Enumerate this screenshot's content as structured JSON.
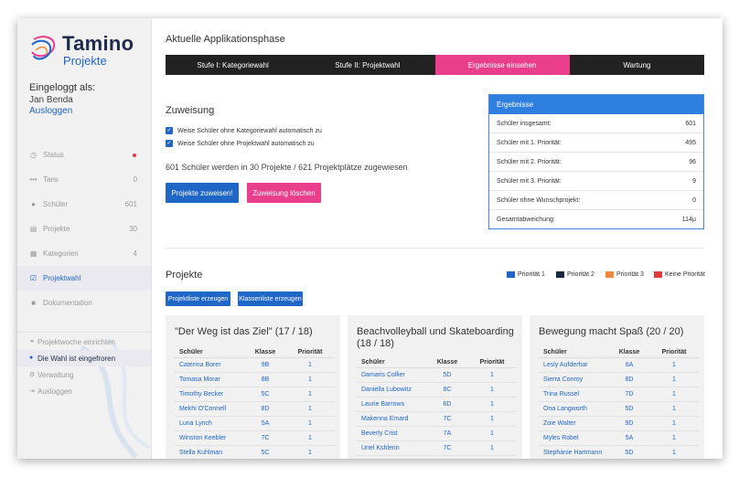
{
  "sidebar": {
    "logo_title": "Tamino",
    "logo_subtitle": "Projekte",
    "login_label": "Eingeloggt als:",
    "user_name": "Jan Benda",
    "logout": "Ausloggen",
    "items": [
      {
        "label": "Status",
        "count": "",
        "icon": "clock-icon"
      },
      {
        "label": "Tans",
        "count": "0",
        "icon": "dots-icon"
      },
      {
        "label": "Schüler",
        "count": "601",
        "icon": "user-icon"
      },
      {
        "label": "Projekte",
        "count": "30",
        "icon": "document-icon"
      },
      {
        "label": "Kategorien",
        "count": "4",
        "icon": "grid-icon"
      },
      {
        "label": "Projektwahl",
        "count": "",
        "icon": "check-square-icon"
      },
      {
        "label": "Dokumentation",
        "count": "",
        "icon": "camera-icon"
      }
    ],
    "sub_items": [
      {
        "label": "Projektwoche einrichten",
        "icon": "link-icon"
      },
      {
        "label": "Die Wahl ist eingefroren",
        "icon": "dot-icon"
      },
      {
        "label": "Verwaltung",
        "icon": "gear-icon"
      },
      {
        "label": "Ausloggen",
        "icon": "logout-icon"
      }
    ]
  },
  "phase": {
    "title": "Aktuelle Applikationsphase",
    "tabs": [
      "Stufe I: Kategoriewahl",
      "Stufe II: Projektwahl",
      "Ergebnisse einsehen",
      "Wartung"
    ],
    "active_index": 2
  },
  "assignment": {
    "title": "Zuweisung",
    "checkbox1": "Weise Schüler ohne Kategoriewahl automatisch zu",
    "checkbox2": "Weise Schüler ohne Projektwahl automatisch zu",
    "summary": "601 Schüler werden in 30 Projekte / 621 Projektplätze zugewiesen",
    "assign_button": "Projekte zuweisen!",
    "delete_button": "Zuweisung löschen"
  },
  "results": {
    "title": "Ergebnisse",
    "rows": [
      {
        "label": "Schüler insgesamt:",
        "value": "601"
      },
      {
        "label": "Schüler mit 1. Priorität:",
        "value": "495"
      },
      {
        "label": "Schüler mit 2. Priorität:",
        "value": "96"
      },
      {
        "label": "Schüler mit 3. Priorität:",
        "value": "9"
      },
      {
        "label": "Schüler ohne Wunschprojekt:",
        "value": "0"
      },
      {
        "label": "Gesamtabweichung:",
        "value": "114µ"
      }
    ]
  },
  "projects": {
    "title": "Projekte",
    "legend": [
      {
        "label": "Priorität 1",
        "color": "#1f66c6"
      },
      {
        "label": "Priorität 2",
        "color": "#1c2740"
      },
      {
        "label": "Priorität 3",
        "color": "#f08a3c"
      },
      {
        "label": "Keine Priorität",
        "color": "#e23b3b"
      }
    ],
    "project_list_button": "Projektliste erzeugen",
    "class_list_button": "Klassenliste erzeugen",
    "table_headers": [
      "Schüler",
      "Klasse",
      "Priorität"
    ],
    "cards": [
      {
        "title": "\"Der Weg ist das Ziel\" (17 / 18)",
        "rows": [
          [
            "Caterina Borer",
            "9B",
            "1"
          ],
          [
            "Tomasa Morar",
            "8B",
            "1"
          ],
          [
            "Timothy Becker",
            "5C",
            "1"
          ],
          [
            "Mekhi O'Connell",
            "8D",
            "1"
          ],
          [
            "Luna Lynch",
            "5A",
            "1"
          ],
          [
            "Winston Keebler",
            "7C",
            "1"
          ],
          [
            "Stella Kuhlman",
            "5C",
            "1"
          ]
        ]
      },
      {
        "title": "Beachvolleyball und Skateboarding (18 / 18)",
        "rows": [
          [
            "Damaris Collier",
            "5D",
            "1"
          ],
          [
            "Daniella Lubowitz",
            "8C",
            "1"
          ],
          [
            "Laurie Barrows",
            "6D",
            "1"
          ],
          [
            "Makenna Emard",
            "7C",
            "1"
          ],
          [
            "Beverly Crist",
            "7A",
            "1"
          ],
          [
            "Uriel Kshlerin",
            "7C",
            "1"
          ]
        ]
      },
      {
        "title": "Bewegung macht Spaß (20 / 20)",
        "rows": [
          [
            "Lesly Aufderhar",
            "6A",
            "1"
          ],
          [
            "Sierra Conroy",
            "8D",
            "1"
          ],
          [
            "Trina Russel",
            "7D",
            "1"
          ],
          [
            "Ona Langworth",
            "5D",
            "1"
          ],
          [
            "Zoie Walter",
            "9D",
            "1"
          ],
          [
            "Myles Robel",
            "5A",
            "1"
          ],
          [
            "Stephanie Hartmann",
            "5D",
            "1"
          ]
        ]
      }
    ]
  }
}
